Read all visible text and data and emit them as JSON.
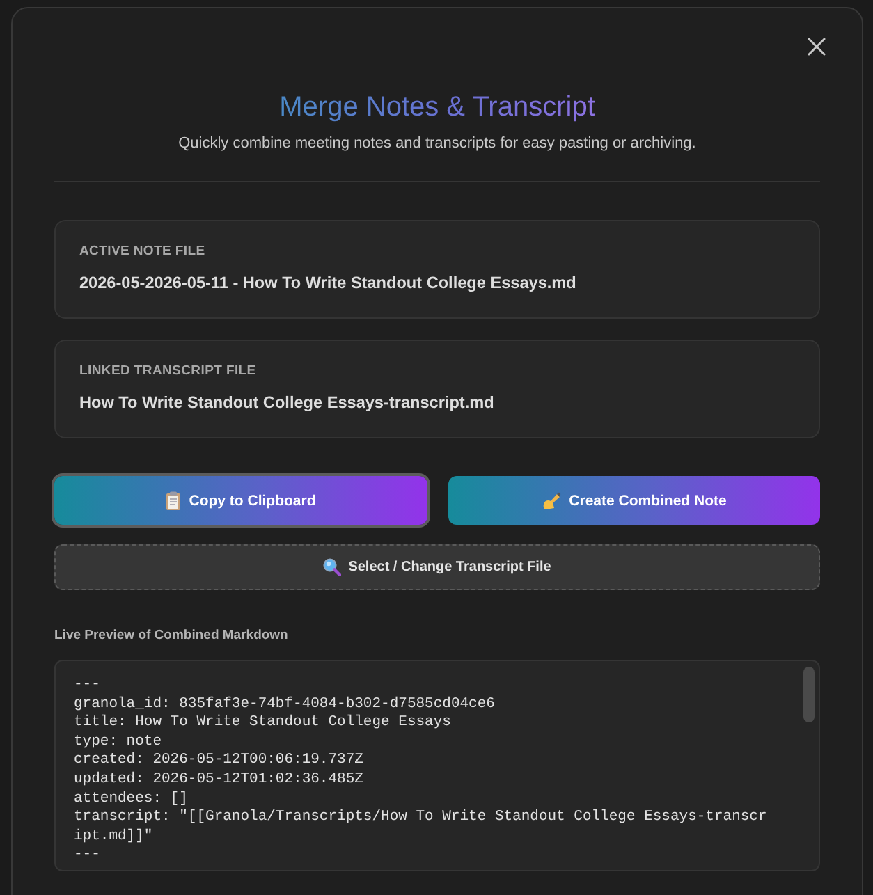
{
  "dialog": {
    "title": "Merge Notes & Transcript",
    "subtitle": "Quickly combine meeting notes and transcripts for easy pasting or archiving."
  },
  "files": [
    {
      "label": "ACTIVE NOTE FILE",
      "value": "2026-05-2026-05-11 - How To Write Standout College Essays.md"
    },
    {
      "label": "LINKED TRANSCRIPT FILE",
      "value": "How To Write Standout College Essays-transcript.md"
    }
  ],
  "actions": [
    {
      "label": "Copy to Clipboard",
      "focused": true
    },
    {
      "label": "Create Combined Note",
      "focused": false
    }
  ],
  "select_button": {
    "label": "Select / Change Transcript File"
  },
  "preview": {
    "heading": "Live Preview of Combined Markdown",
    "lines": [
      "---",
      "granola_id: 835faf3e-74bf-4084-b302-d7585cd04ce6",
      "title: How To Write Standout College Essays",
      "type: note",
      "created: 2026-05-12T00:06:19.737Z",
      "updated: 2026-05-12T01:02:36.485Z",
      "attendees: []",
      "transcript: \"[[Granola/Transcripts/How To Write Standout College Essays-transcript.md]]\"",
      "---"
    ]
  }
}
